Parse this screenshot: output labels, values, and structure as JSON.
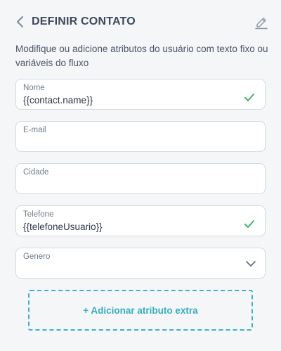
{
  "header": {
    "title": "DEFINIR CONTATO",
    "back_icon": "chevron-left-icon",
    "edit_icon": "pencil-icon"
  },
  "description": "Modifique ou adicione atributos do usuário com texto fixo ou variáveis do fluxo",
  "fields": [
    {
      "label": "Nome",
      "value": "{{contact.name}}",
      "valid": true
    },
    {
      "label": "E-mail",
      "value": "",
      "valid": false
    },
    {
      "label": "Cidade",
      "value": "",
      "valid": false
    },
    {
      "label": "Telefone",
      "value": "{{telefoneUsuario}}",
      "valid": true
    },
    {
      "label": "Genero",
      "value": "",
      "type": "select"
    }
  ],
  "add_button_label": "+ Adicionar atributo extra",
  "colors": {
    "accent": "#36aebf",
    "check": "#3bb56b",
    "icon": "#7a8aa0"
  }
}
